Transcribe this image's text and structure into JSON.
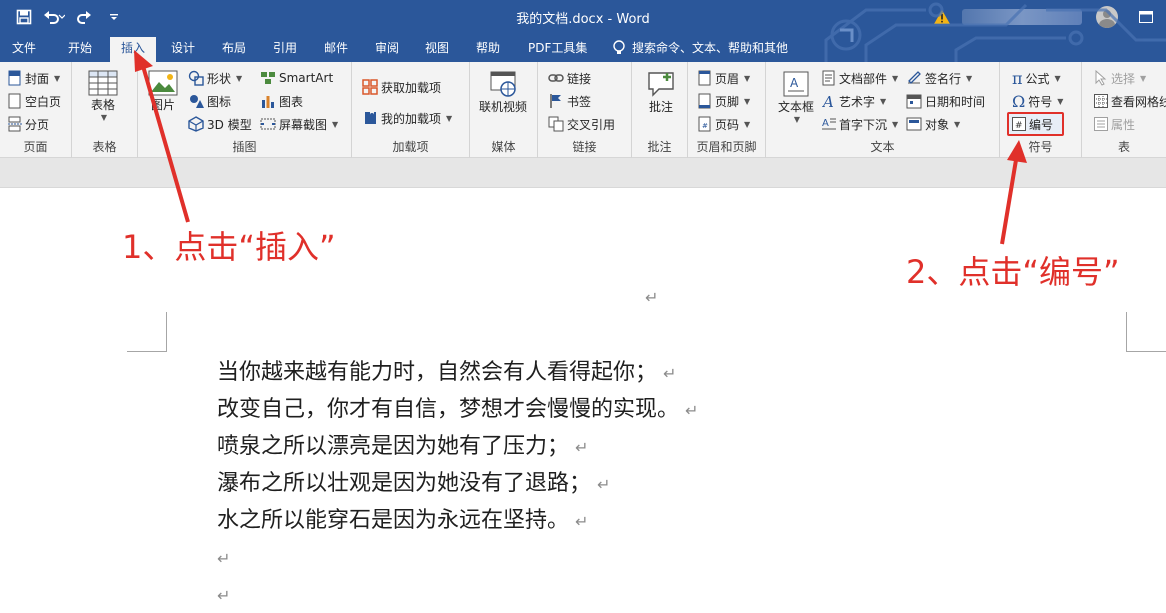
{
  "titlebar": {
    "doc_title": "我的文档.docx  -  Word"
  },
  "tabs": [
    {
      "label": "文件"
    },
    {
      "label": "开始"
    },
    {
      "label": "插入"
    },
    {
      "label": "设计"
    },
    {
      "label": "布局"
    },
    {
      "label": "引用"
    },
    {
      "label": "邮件"
    },
    {
      "label": "审阅"
    },
    {
      "label": "视图"
    },
    {
      "label": "帮助"
    },
    {
      "label": "PDF工具集"
    }
  ],
  "tell_me": "搜索命令、文本、帮助和其他",
  "ribbon": {
    "pages": {
      "label": "页面",
      "cover": "封面",
      "blank_page": "空白页",
      "page_break": "分页"
    },
    "tables": {
      "label": "表格",
      "table": "表格"
    },
    "illustrations": {
      "label": "插图",
      "pictures": "图片",
      "shapes": "形状",
      "icons": "图标",
      "model3d": "3D 模型",
      "smartart": "SmartArt",
      "chart": "图表",
      "screenshot": "屏幕截图"
    },
    "addins": {
      "label": "加载项",
      "get_addins": "获取加载项",
      "my_addins": "我的加载项"
    },
    "media": {
      "label": "媒体",
      "online_video": "联机视频"
    },
    "links": {
      "label": "链接",
      "link": "链接",
      "bookmark": "书签",
      "cross_ref": "交叉引用"
    },
    "comments": {
      "label": "批注",
      "comment": "批注"
    },
    "header_footer": {
      "label": "页眉和页脚",
      "header": "页眉",
      "footer": "页脚",
      "page_number": "页码"
    },
    "text": {
      "label": "文本",
      "text_box": "文本框",
      "quick_parts": "文档部件",
      "wordart": "艺术字",
      "drop_cap": "首字下沉",
      "signature_line": "签名行",
      "date_time": "日期和时间",
      "object": "对象"
    },
    "symbols": {
      "label": "符号",
      "equation": "公式",
      "symbol": "符号",
      "number": "编号"
    },
    "table_group": {
      "label": "表",
      "select": "选择",
      "view_gridlines": "查看网格线",
      "properties": "属性"
    }
  },
  "document": {
    "lines": [
      "当你越来越有能力时，自然会有人看得起你；",
      "改变自己，你才有自信，梦想才会慢慢的实现。",
      "喷泉之所以漂亮是因为她有了压力；",
      "瀑布之所以壮观是因为她没有了退路；",
      "水之所以能穿石是因为永远在坚持。"
    ],
    "para_mark": "↵"
  },
  "annotations": {
    "step1": "1、点击“插入”",
    "step2": "2、点击“编号”"
  },
  "colors": {
    "brand": "#2b579a",
    "annotation": "#e0302a"
  }
}
